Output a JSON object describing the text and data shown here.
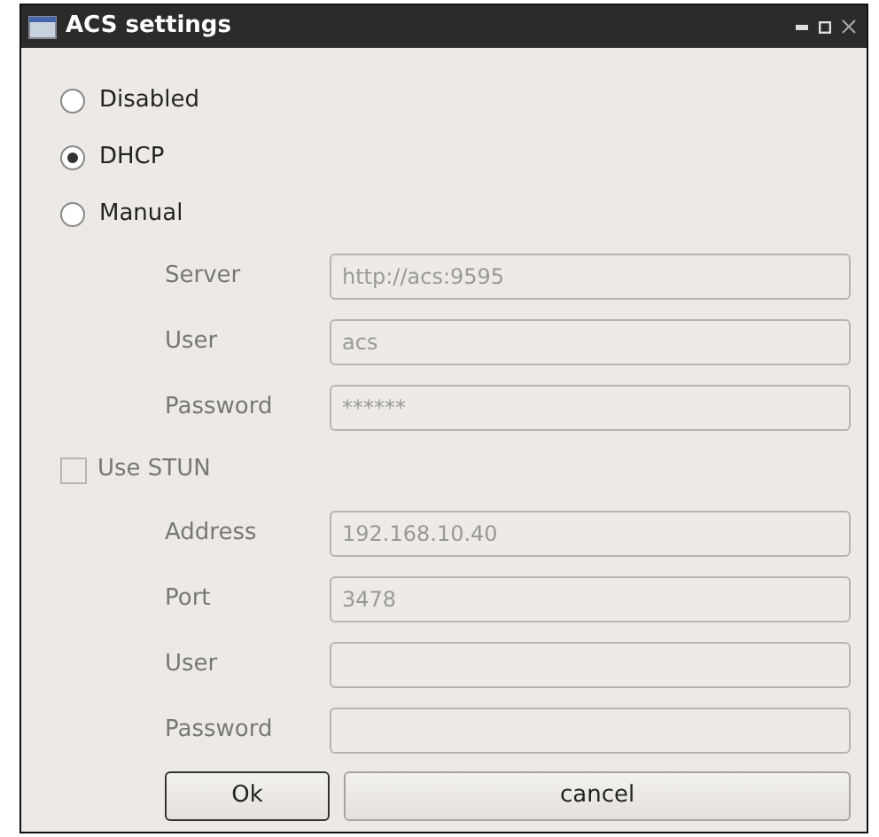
{
  "window": {
    "title": "ACS settings"
  },
  "modes": [
    {
      "label": "Disabled",
      "selected": false
    },
    {
      "label": "DHCP",
      "selected": true
    },
    {
      "label": "Manual",
      "selected": false
    }
  ],
  "manual_fields": [
    {
      "label": "Server",
      "value": "http://acs:9595",
      "disabled": true
    },
    {
      "label": "User",
      "value": "acs",
      "disabled": true
    },
    {
      "label": "Password",
      "value": "******",
      "disabled": true
    }
  ],
  "stun": {
    "label": "Use STUN",
    "checked": false,
    "disabled": true
  },
  "stun_fields": [
    {
      "label": "Address",
      "value": "192.168.10.40",
      "disabled": true
    },
    {
      "label": "Port",
      "value": "3478",
      "disabled": true
    },
    {
      "label": "User",
      "disabled": true
    },
    {
      "label": "Password",
      "disabled": true
    }
  ],
  "buttons": [
    {
      "label": "Ok",
      "default": true
    },
    {
      "label": "cancel",
      "default": false
    }
  ]
}
